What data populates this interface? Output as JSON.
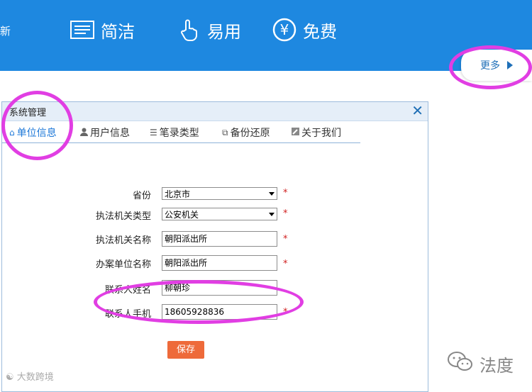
{
  "banner": {
    "left_fragment": "新",
    "features": [
      {
        "label": "简洁",
        "icon": "list-icon"
      },
      {
        "label": "易用",
        "icon": "hand-pointer-icon"
      },
      {
        "label": "免费",
        "icon": "yen-icon"
      }
    ],
    "more_label": "更多"
  },
  "dialog": {
    "title": "系统管理",
    "close_glyph": "✕",
    "tabs": [
      {
        "label": "单位信息",
        "icon": "home-icon",
        "active": true
      },
      {
        "label": "用户信息",
        "icon": "user-icon",
        "active": false
      },
      {
        "label": "笔录类型",
        "icon": "list-icon",
        "active": false
      },
      {
        "label": "备份还原",
        "icon": "copy-icon",
        "active": false
      },
      {
        "label": "关于我们",
        "icon": "edit-icon",
        "active": false
      }
    ],
    "form": {
      "province_label": "省份",
      "province_value": "北京市",
      "agency_type_label": "执法机关类型",
      "agency_type_value": "公安机关",
      "agency_name_label": "执法机关名称",
      "agency_name_value": "朝阳派出所",
      "handling_unit_label": "办案单位名称",
      "handling_unit_value": "朝阳派出所",
      "contact_name_label": "联系人姓名",
      "contact_name_value": "柳朝珍",
      "contact_phone_label": "联系人手机",
      "contact_phone_value": "18605928836",
      "required_mark": "*",
      "save_label": "保存"
    }
  },
  "watermarks": {
    "right": "法度",
    "left": "大数跨境"
  },
  "colors": {
    "banner_blue": "#1e88e0",
    "highlight_magenta": "#e13ee3",
    "save_orange": "#ee6a3a"
  }
}
